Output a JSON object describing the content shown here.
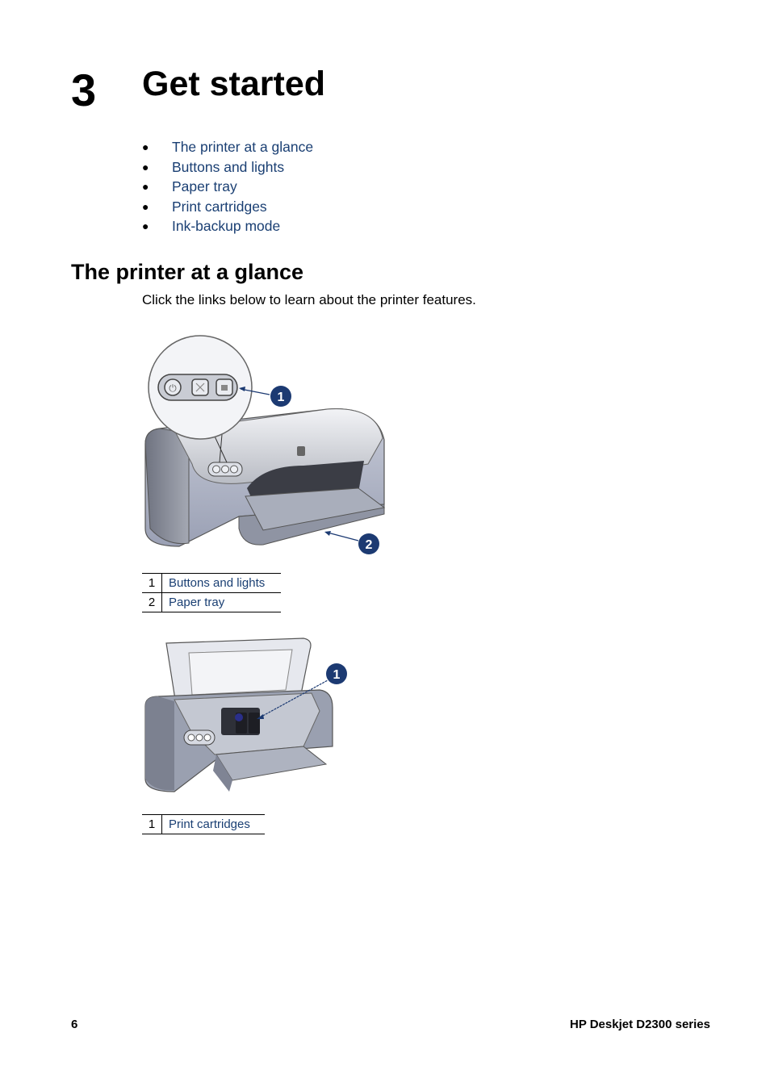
{
  "chapter": {
    "number": "3",
    "title": "Get started"
  },
  "toc": [
    {
      "bullet": "●",
      "label": "The printer at a glance"
    },
    {
      "bullet": "●",
      "label": "Buttons and lights"
    },
    {
      "bullet": "●",
      "label": "Paper tray"
    },
    {
      "bullet": "●",
      "label": "Print cartridges"
    },
    {
      "bullet": "●",
      "label": "Ink-backup mode"
    }
  ],
  "section": {
    "title": "The printer at a glance",
    "intro": "Click the links below to learn about the printer features."
  },
  "figure1": {
    "alt": "Printer exterior with button panel callout",
    "callouts": [
      "1",
      "2"
    ],
    "table": [
      {
        "num": "1",
        "label": "Buttons and lights"
      },
      {
        "num": "2",
        "label": "Paper tray"
      }
    ]
  },
  "figure2": {
    "alt": "Printer with open cover showing print cartridges",
    "callouts": [
      "1"
    ],
    "table": [
      {
        "num": "1",
        "label": "Print cartridges"
      }
    ]
  },
  "footer": {
    "page": "6",
    "product": "HP Deskjet D2300 series"
  },
  "colors": {
    "link": "#1a3f73",
    "callout": "#1c3a72"
  }
}
